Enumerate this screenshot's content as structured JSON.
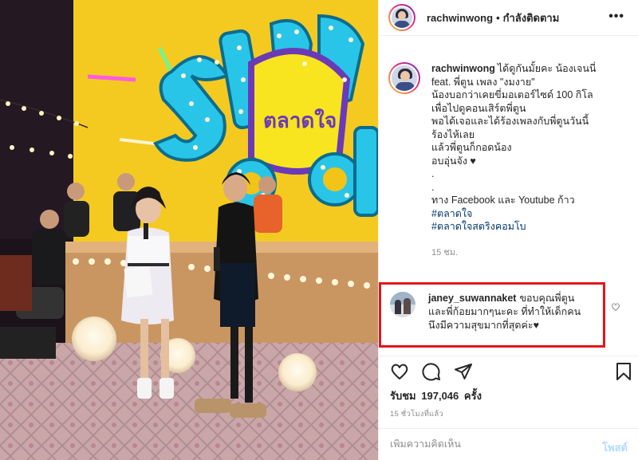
{
  "post": {
    "username": "rachwinwong",
    "separator": "•",
    "follow_status": "กำลังติดตาม",
    "more_label": "•••"
  },
  "caption": {
    "username": "rachwinwong",
    "lines": [
      "ได้ดูกันมั้ยคะ น้องเจนนี่",
      "feat. พี่ตูน เพลง \"งมงาย\"",
      "น้องบอกว่าเคยขี่มอเตอร์ไซด์ 100 กิโล",
      "เพื่อไปดูคอนเสิร์ตพี่ตูน",
      "พอได้เจอและได้ร้องเพลงกับพี่ตูนวันนี้",
      "ร้องไห้เลย",
      "แล้วพี่ตูนก็กอดน้อง",
      "อบอุ่นจัง ♥",
      ".",
      ".",
      "ทาง Facebook และ Youtube ก้าว"
    ],
    "hashtags": [
      "#ตลาดใจ",
      "#ตลาดใจสตริงคอมโบ"
    ],
    "time": "15 ชม."
  },
  "comment": {
    "username": "janey_suwannaket",
    "lines": [
      "ขอบคุณพี่ตูน",
      "และพี่ก้อยมากๆนะคะ ที่ทำให้เด็กคน",
      "นึงมีความสุขมากที่สุดค่ะ♥"
    ]
  },
  "stats": {
    "likes_prefix": "รับชม",
    "likes_count": "197,046",
    "likes_suffix": "ครั้ง",
    "posted_ago": "15 ชั่วโมงที่แล้ว"
  },
  "add_comment": {
    "placeholder": "เพิ่มความคิดเห็น",
    "post_label": "โพสต์"
  },
  "icons": {
    "like": "heart-icon",
    "comment": "comment-icon",
    "share": "share-icon",
    "save": "bookmark-icon",
    "comment_like": "heart-icon"
  },
  "colors": {
    "highlight_border": "#e2171b",
    "link": "#00376b",
    "post_button": "#b3dbff",
    "muted": "#8e8e8e"
  }
}
